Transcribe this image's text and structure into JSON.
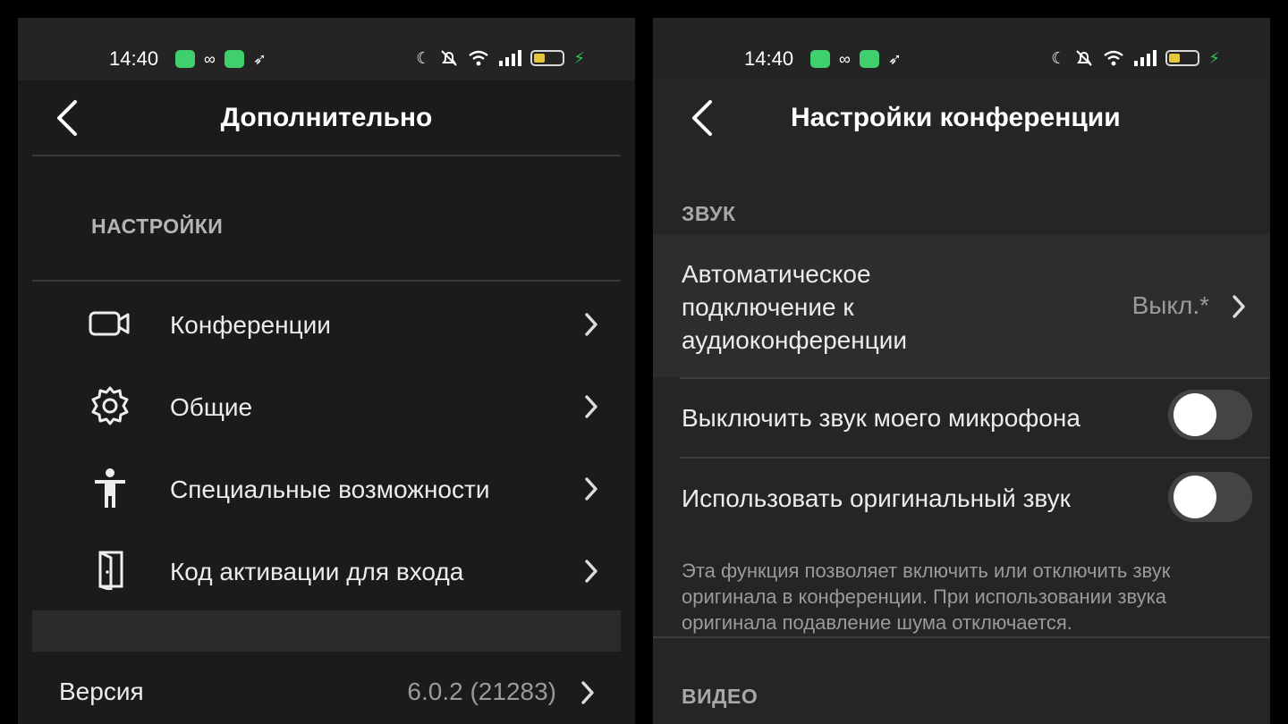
{
  "status_bar": {
    "time": "14:40",
    "icons": [
      "chat-app-icon",
      "link-icon",
      "mail-app-icon",
      "bird-icon",
      "moon-icon",
      "muted-bell-icon",
      "wifi-icon",
      "signal-icon",
      "battery-icon",
      "charging-icon"
    ],
    "battery_color": "#e6c63a",
    "charging_color": "#34c759"
  },
  "left": {
    "title": "Дополнительно",
    "section_header": "НАСТРОЙКИ",
    "items": [
      {
        "label": "Конференции",
        "icon": "video-camera-icon"
      },
      {
        "label": "Общие",
        "icon": "gear-icon"
      },
      {
        "label": "Специальные возможности",
        "icon": "accessibility-icon"
      },
      {
        "label": "Код активации для входа",
        "icon": "door-icon"
      }
    ],
    "version": {
      "label": "Версия",
      "value": "6.0.2 (21283)"
    }
  },
  "right": {
    "title": "Настройки конференции",
    "sound_section": "ЗВУК",
    "auto_connect": {
      "line1": "Автоматическое",
      "line2": "подключение к",
      "line3": "аудиоконференции",
      "value": "Выкл.*"
    },
    "mute_mic": {
      "label": "Выключить звук моего микрофона",
      "enabled": false
    },
    "original_sound": {
      "label": "Использовать оригинальный звук",
      "enabled": false
    },
    "description": "Эта функция позволяет включить или отключить звук оригинала в конференции. При использовании звука оригинала подавление шума отключается.",
    "video_section": "ВИДЕО"
  }
}
